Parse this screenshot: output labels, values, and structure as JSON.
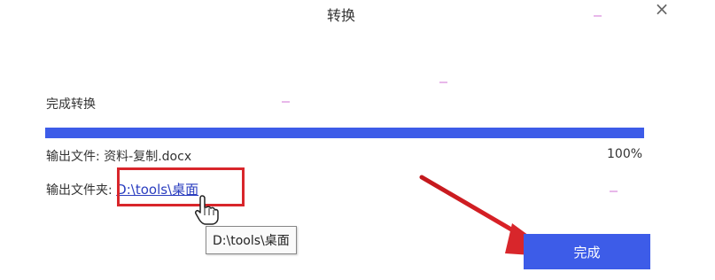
{
  "dialog": {
    "title": "转换",
    "close_symbol": "×",
    "status": "完成转换",
    "progress_percent": 100,
    "progress_label": "100%",
    "output_file_label": "输出文件: ",
    "output_file_name": "资料-复制.docx",
    "output_folder_label": "输出文件夹:",
    "output_folder_path": "D:\\tools\\桌面",
    "tooltip_text": "D:\\tools\\桌面",
    "done_label": "完成"
  },
  "colors": {
    "accent": "#3d5ce8",
    "highlight": "#d8262b",
    "link": "#2a3dbf"
  },
  "icons": [
    "close-icon",
    "hand-pointer-icon",
    "red-arrow-annotation"
  ]
}
